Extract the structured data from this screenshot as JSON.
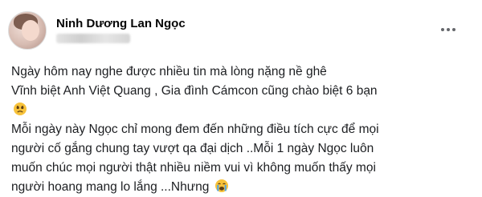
{
  "post": {
    "author": "Ninh Dương Lan Ngọc",
    "icons": {
      "more": "more-options-icon",
      "emoji_sad": "sad-face-emoji-icon",
      "emoji_crying": "loudly-crying-face-emoji-icon"
    },
    "lines": [
      "Ngày hôm nay nghe được nhiều tin mà lòng nặng nề ghê",
      "Vĩnh biệt Anh Việt Quang , Gia đình Cámcon cũng chào biệt 6 bạn",
      "",
      "Mỗi ngày này Ngọc chỉ mong đem đến những điều tích cực để mọi",
      "người cố gắng chung tay vượt qa đại dịch ..Mỗi 1 ngày Ngọc luôn",
      "muốn chúc mọi người thật nhiều niềm vui vì không muốn thấy mọi",
      "người hoang mang lo lắng ...Nhưng"
    ]
  }
}
